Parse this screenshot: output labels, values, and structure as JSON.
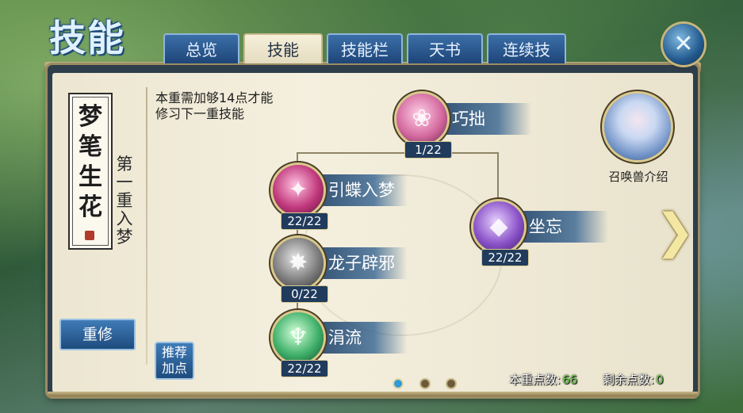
{
  "window": {
    "title": "技能"
  },
  "tabs": [
    {
      "label": "总览",
      "active": false
    },
    {
      "label": "技能",
      "active": true
    },
    {
      "label": "技能栏",
      "active": false
    },
    {
      "label": "天书",
      "active": false
    },
    {
      "label": "连续技",
      "active": false
    }
  ],
  "close_button": {
    "icon": "close-icon",
    "glyph": "✕"
  },
  "sect": {
    "name": "梦笔生花",
    "tier_name": "第一重入梦"
  },
  "notice": "本重需加够14点才能修习下一重技能",
  "skills": [
    {
      "name": "巧拙",
      "points": "1/22",
      "icon": "pink-lotus-icon",
      "color": "#d46aa0"
    },
    {
      "name": "引蝶入梦",
      "points": "22/22",
      "icon": "butterfly-dream-icon",
      "color": "#c0387c"
    },
    {
      "name": "坐忘",
      "points": "22/22",
      "icon": "crystal-icon",
      "color": "#8a52c8"
    },
    {
      "name": "龙子辟邪",
      "points": "0/22",
      "icon": "dragon-icon",
      "color": "#7d7d7d"
    },
    {
      "name": "涓流",
      "points": "22/22",
      "icon": "water-spirit-icon",
      "color": "#3fb06a"
    }
  ],
  "pet": {
    "label": "召唤兽介绍",
    "icon": "pet-portrait-icon"
  },
  "buttons": {
    "reset": "重修",
    "recommend": "推荐加点"
  },
  "next_arrow": {
    "icon": "chevron-right-icon",
    "glyph": "❯"
  },
  "pagination": {
    "pages": 3,
    "active": 1,
    "active_color": "#2f9ad6",
    "inactive_color": "#6b5a3a"
  },
  "stats": [
    {
      "label": "本重点数:",
      "value": "66"
    },
    {
      "label": "剩余点数:",
      "value": "0"
    }
  ]
}
